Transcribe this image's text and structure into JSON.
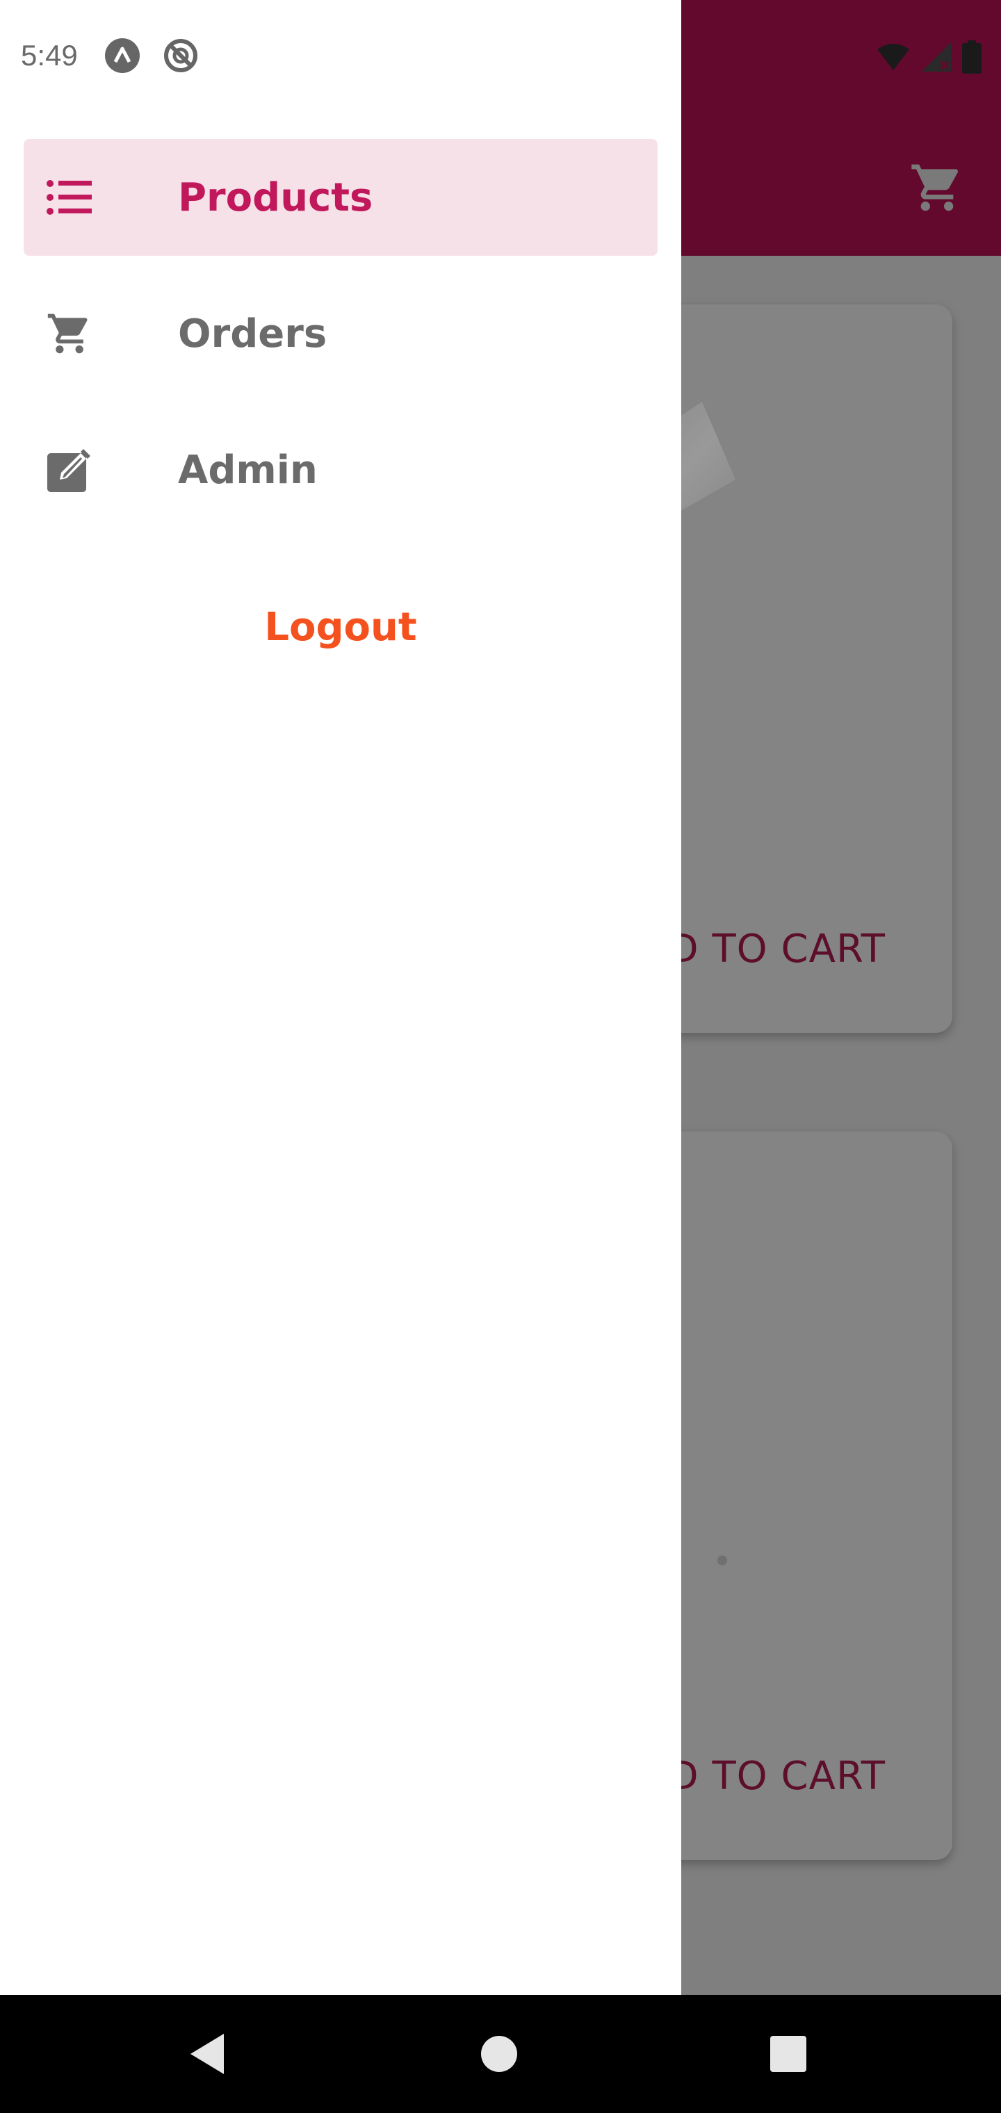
{
  "status_bar": {
    "time": "5:49",
    "left_icons": [
      "app-notification-icon",
      "blocked-icon"
    ],
    "right_icons": [
      "wifi-icon",
      "cellular-no-signal-icon",
      "battery-icon"
    ]
  },
  "app_bar": {
    "background_color": "#63092d",
    "cart_icon": "shopping-cart-icon"
  },
  "background_cards": [
    {
      "action_label_visible": "DD TO CART"
    },
    {
      "action_label_visible": "DD TO CART"
    }
  ],
  "drawer": {
    "items": [
      {
        "label": "Products",
        "icon": "list-icon",
        "active": true
      },
      {
        "label": "Orders",
        "icon": "shopping-cart-icon",
        "active": false
      },
      {
        "label": "Admin",
        "icon": "edit-icon",
        "active": false
      }
    ],
    "logout_label": "Logout"
  },
  "colors": {
    "accent": "#c0185b",
    "active_bg": "#f7e1e8",
    "logout": "#f4511e",
    "inactive_text": "#6b6b6b"
  },
  "system_nav": {
    "buttons": [
      "back-icon",
      "home-icon",
      "recents-icon"
    ]
  }
}
